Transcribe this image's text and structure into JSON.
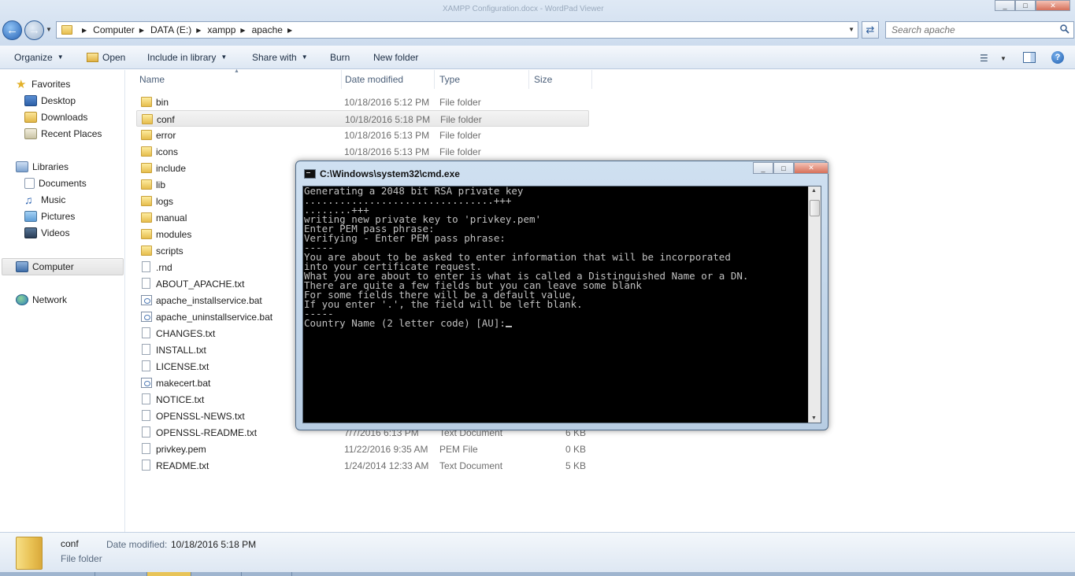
{
  "window": {
    "title_faded": "XAMPP Configuration.docx - WordPad Viewer",
    "minimize": "_",
    "maximize": "□",
    "close": "✕"
  },
  "address": {
    "crumbs": [
      "Computer",
      "DATA (E:)",
      "xampp",
      "apache"
    ],
    "search_placeholder": "Search apache"
  },
  "commands": {
    "organize": "Organize",
    "open": "Open",
    "include": "Include in library",
    "share": "Share with",
    "burn": "Burn",
    "new_folder": "New folder"
  },
  "nav": {
    "favorites": "Favorites",
    "desktop": "Desktop",
    "downloads": "Downloads",
    "recent": "Recent Places",
    "libraries": "Libraries",
    "documents": "Documents",
    "music": "Music",
    "pictures": "Pictures",
    "videos": "Videos",
    "computer": "Computer",
    "network": "Network"
  },
  "columns": {
    "name": "Name",
    "date": "Date modified",
    "type": "Type",
    "size": "Size"
  },
  "files": [
    {
      "name": "bin",
      "date": "10/18/2016 5:12 PM",
      "type": "File folder",
      "size": ""
    },
    {
      "name": "conf",
      "date": "10/18/2016 5:18 PM",
      "type": "File folder",
      "size": ""
    },
    {
      "name": "error",
      "date": "10/18/2016 5:13 PM",
      "type": "File folder",
      "size": ""
    },
    {
      "name": "icons",
      "date": "10/18/2016 5:13 PM",
      "type": "File folder",
      "size": ""
    },
    {
      "name": "include",
      "date": "",
      "type": "",
      "size": ""
    },
    {
      "name": "lib",
      "date": "",
      "type": "",
      "size": ""
    },
    {
      "name": "logs",
      "date": "",
      "type": "",
      "size": ""
    },
    {
      "name": "manual",
      "date": "",
      "type": "",
      "size": ""
    },
    {
      "name": "modules",
      "date": "",
      "type": "",
      "size": ""
    },
    {
      "name": "scripts",
      "date": "",
      "type": "",
      "size": ""
    },
    {
      "name": ".rnd",
      "date": "",
      "type": "",
      "size": ""
    },
    {
      "name": "ABOUT_APACHE.txt",
      "date": "",
      "type": "",
      "size": ""
    },
    {
      "name": "apache_installservice.bat",
      "date": "",
      "type": "",
      "size": ""
    },
    {
      "name": "apache_uninstallservice.bat",
      "date": "",
      "type": "",
      "size": ""
    },
    {
      "name": "CHANGES.txt",
      "date": "",
      "type": "",
      "size": ""
    },
    {
      "name": "INSTALL.txt",
      "date": "",
      "type": "",
      "size": ""
    },
    {
      "name": "LICENSE.txt",
      "date": "",
      "type": "",
      "size": ""
    },
    {
      "name": "makecert.bat",
      "date": "",
      "type": "",
      "size": ""
    },
    {
      "name": "NOTICE.txt",
      "date": "",
      "type": "",
      "size": ""
    },
    {
      "name": "OPENSSL-NEWS.txt",
      "date": "",
      "type": "",
      "size": ""
    },
    {
      "name": "OPENSSL-README.txt",
      "date": "7/7/2016 6:13 PM",
      "type": "Text Document",
      "size": "6 KB"
    },
    {
      "name": "privkey.pem",
      "date": "11/22/2016 9:35 AM",
      "type": "PEM File",
      "size": "0 KB"
    },
    {
      "name": "README.txt",
      "date": "1/24/2014 12:33 AM",
      "type": "Text Document",
      "size": "5 KB"
    }
  ],
  "details": {
    "name": "conf",
    "date_label": "Date modified:",
    "date": "10/18/2016 5:18 PM",
    "type": "File folder"
  },
  "cmd": {
    "title": "C:\\Windows\\system32\\cmd.exe",
    "lines": [
      "Generating a 2048 bit RSA private key",
      "................................+++",
      "........+++",
      "writing new private key to 'privkey.pem'",
      "Enter PEM pass phrase:",
      "Verifying - Enter PEM pass phrase:",
      "-----",
      "You are about to be asked to enter information that will be incorporated",
      "into your certificate request.",
      "What you are about to enter is what is called a Distinguished Name or a DN.",
      "There are quite a few fields but you can leave some blank",
      "For some fields there will be a default value,",
      "If you enter '.', the field will be left blank.",
      "-----",
      "Country Name (2 letter code) [AU]:"
    ]
  }
}
